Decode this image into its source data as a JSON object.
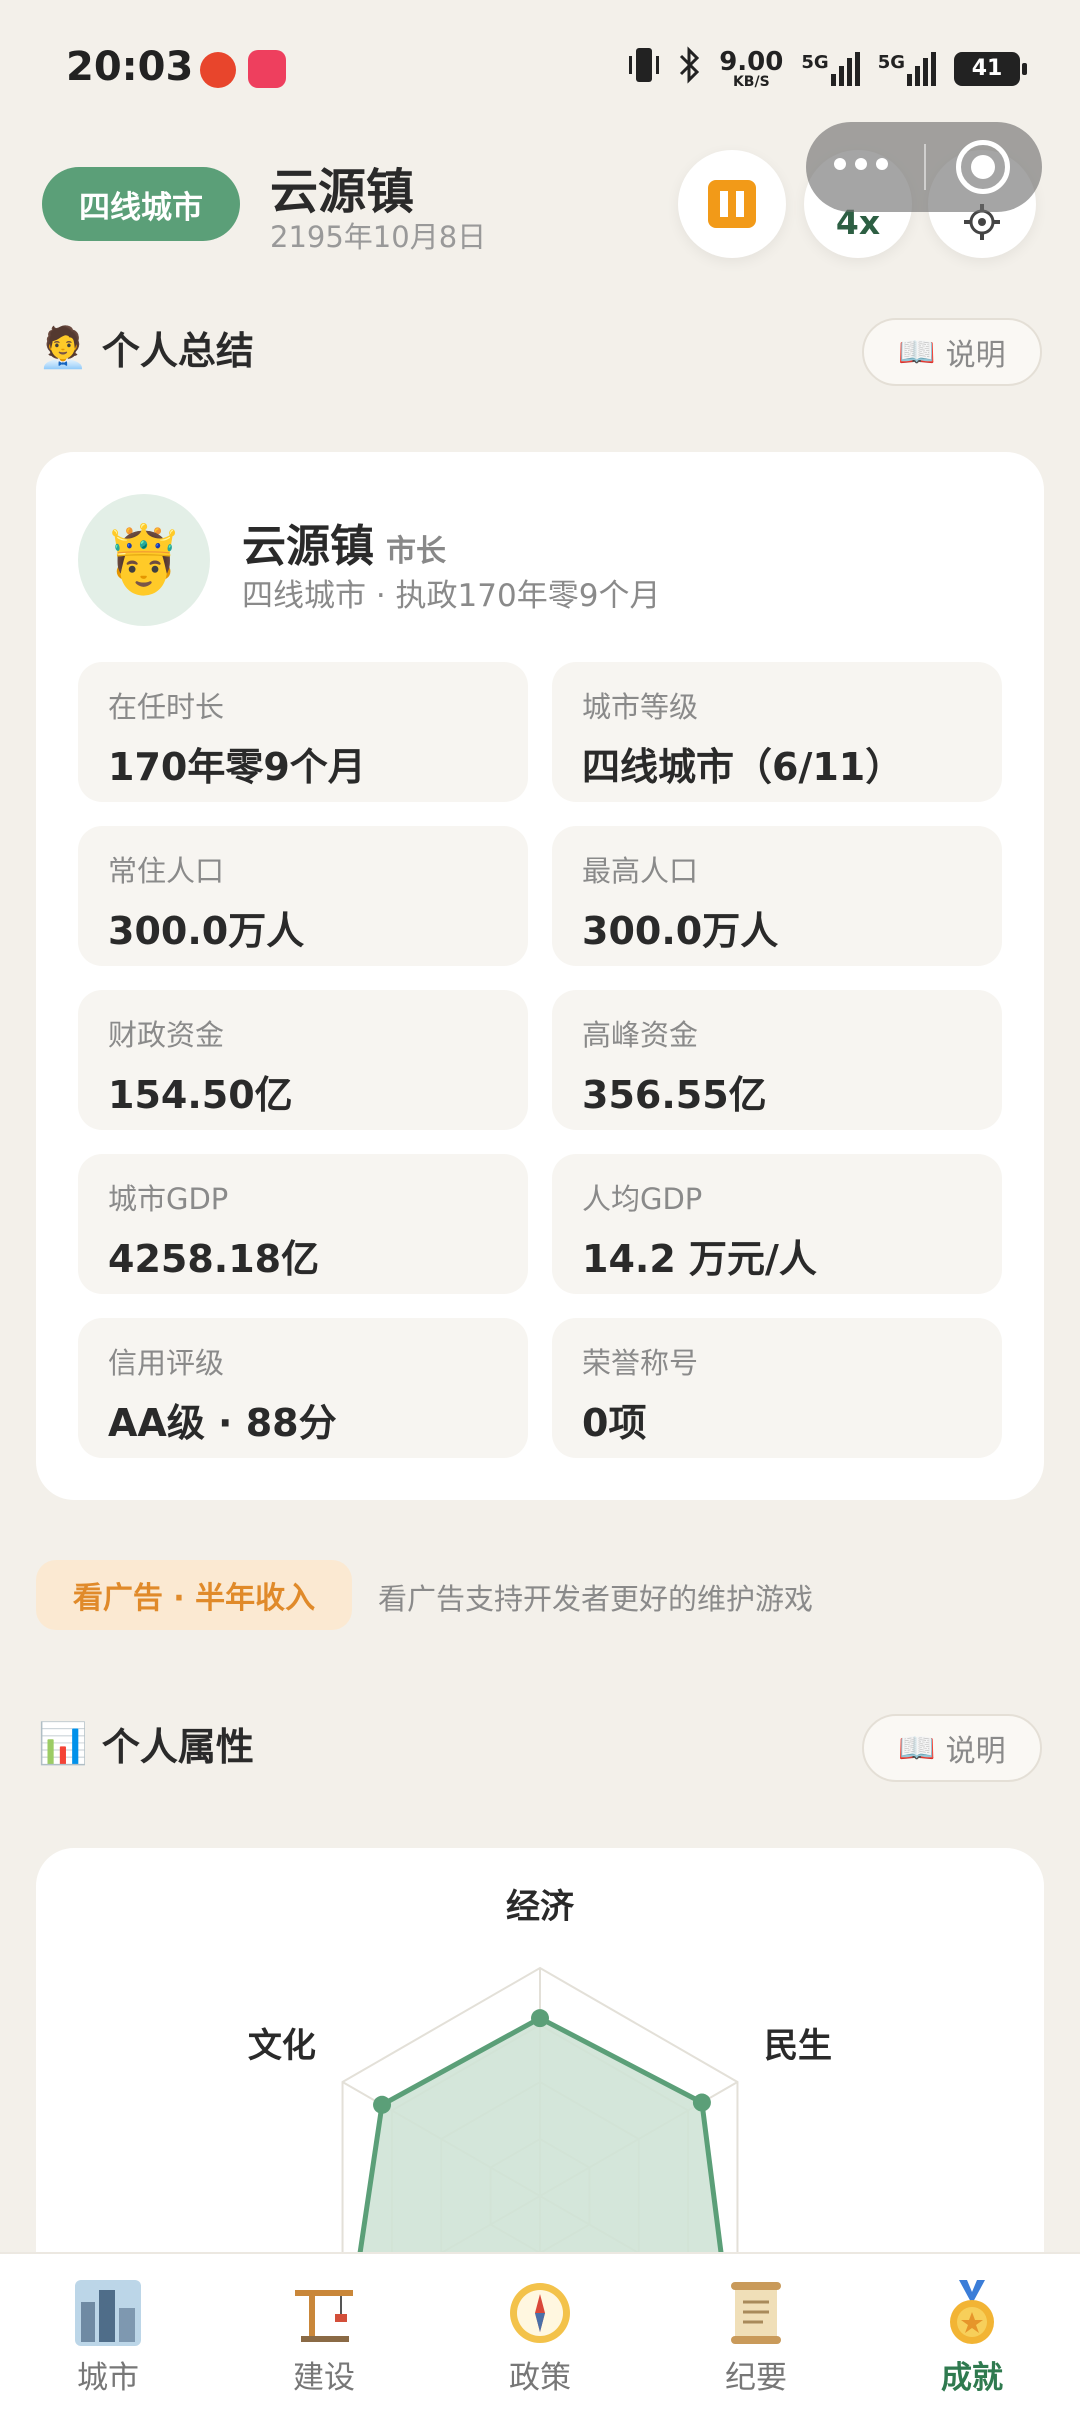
{
  "status_bar": {
    "time": "20:03",
    "net_speed": "9.00",
    "net_unit": "KB/S",
    "sig1": "5G",
    "sig2": "5G",
    "battery": "41"
  },
  "header": {
    "city_tier": "四线城市",
    "town_name": "云源镇",
    "date": "2195年10月8日",
    "speed_label": "4x"
  },
  "summary": {
    "section_title": "个人总结",
    "section_emoji": "🧑‍💼",
    "help_label": "说明",
    "avatar_emoji": "🤴",
    "profile_name": "云源镇",
    "profile_role": "市长",
    "profile_sub": "四线城市 · 执政170年零9个月",
    "stats": [
      {
        "label": "在任时长",
        "value": "170年零9个月"
      },
      {
        "label": "城市等级",
        "value": "四线城市（6/11）"
      },
      {
        "label": "常住人口",
        "value": "300.0万人"
      },
      {
        "label": "最高人口",
        "value": "300.0万人"
      },
      {
        "label": "财政资金",
        "value": "154.50亿"
      },
      {
        "label": "高峰资金",
        "value": "356.55亿"
      },
      {
        "label": "城市GDP",
        "value": "4258.18亿"
      },
      {
        "label": "人均GDP",
        "value": "14.2 万元/人"
      },
      {
        "label": "信用评级",
        "value": "AA级 · 88分"
      },
      {
        "label": "荣誉称号",
        "value": "0项"
      }
    ]
  },
  "ad": {
    "button_label": "看广告 · 半年收入",
    "text": "看广告支持开发者更好的维护游戏"
  },
  "attributes": {
    "section_title": "个人属性",
    "section_emoji": "📊",
    "help_label": "说明",
    "radar_labels": [
      "经济",
      "民生",
      "文化"
    ],
    "radar_values": [
      0.78,
      0.82,
      0.8
    ]
  },
  "nav": {
    "items": [
      {
        "label": "城市",
        "icon": "city-icon"
      },
      {
        "label": "建设",
        "icon": "crane-icon"
      },
      {
        "label": "政策",
        "icon": "compass-icon"
      },
      {
        "label": "纪要",
        "icon": "scroll-icon"
      },
      {
        "label": "成就",
        "icon": "medal-icon"
      }
    ],
    "active_index": 4
  },
  "colors": {
    "accent": "#5b9f78",
    "active_nav": "#2f7a4f",
    "pause": "#f29a18",
    "ad": "#e08a2a",
    "radar_fill": "#cfe3d6",
    "radar_stroke": "#5b9f78"
  }
}
